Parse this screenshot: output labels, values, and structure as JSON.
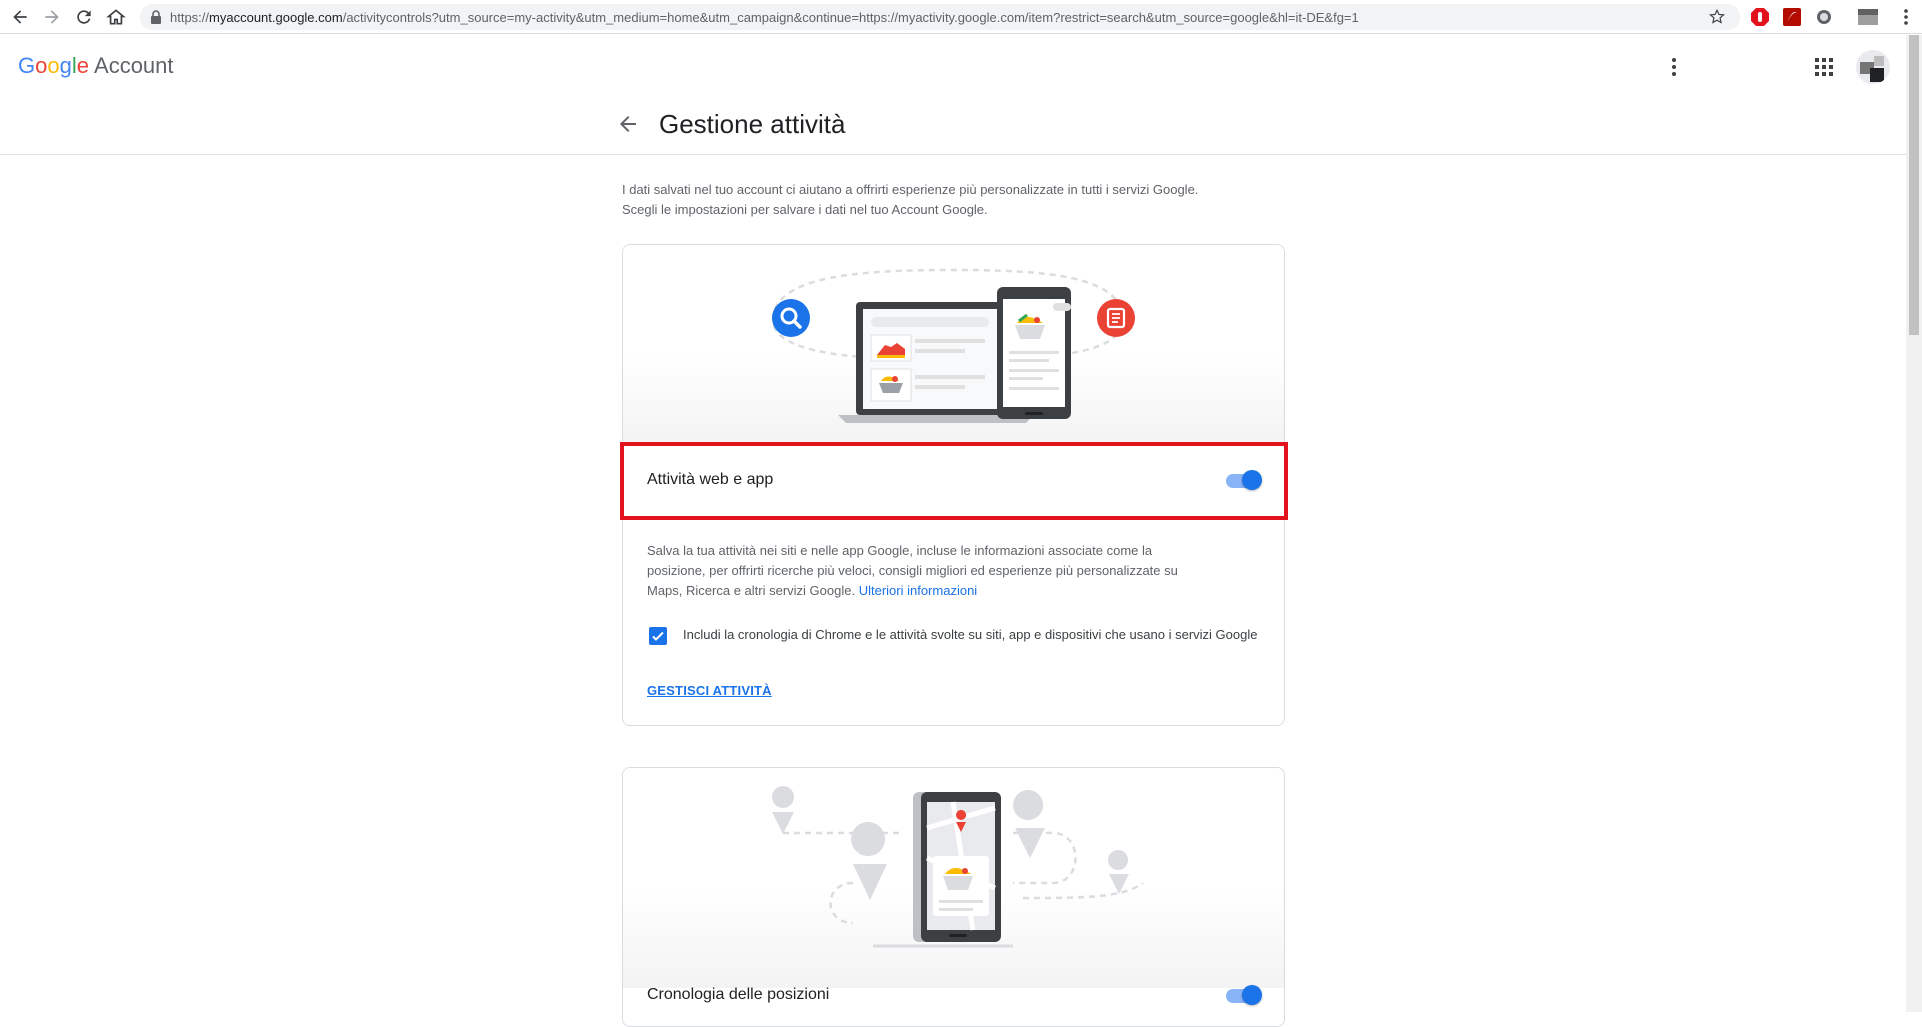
{
  "browser": {
    "url_prefix": "https://",
    "url_host": "myaccount.google.com",
    "url_path": "/activitycontrols?utm_source=my-activity&utm_medium=home&utm_campaign&continue=https://myactivity.google.com/item?restrict=search&utm_source=google&hl=it-DE&fg=1"
  },
  "header": {
    "logo_google": [
      "G",
      "o",
      "o",
      "g",
      "l",
      "e"
    ],
    "logo_account": "Account",
    "title": "Gestione attività"
  },
  "intro": {
    "line1": "I dati salvati nel tuo account ci aiutano a offrirti esperienze più personalizzate in tutti i servizi Google.",
    "line2": "Scegli le impostazioni per salvare i dati nel tuo Account Google."
  },
  "web_app_card": {
    "label": "Attività web e app",
    "toggle_on": true,
    "description": "Salva la tua attività nei siti e nelle app Google, incluse le informazioni associate come la posizione, per offrirti ricerche più veloci, consigli migliori ed esperienze più personalizzate su Maps, Ricerca e altri servizi Google.",
    "learn_more": "Ulteriori informazioni",
    "checkbox_checked": true,
    "checkbox_label": "Includi la cronologia di Chrome e le attività svolte su siti, app e dispositivi che usano i servizi Google",
    "manage_link": "GESTISCI ATTIVITÀ"
  },
  "location_card": {
    "label": "Cronologia delle posizioni",
    "toggle_on": true
  },
  "colors": {
    "accent": "#1a73e8",
    "highlight": "#e2131d"
  }
}
